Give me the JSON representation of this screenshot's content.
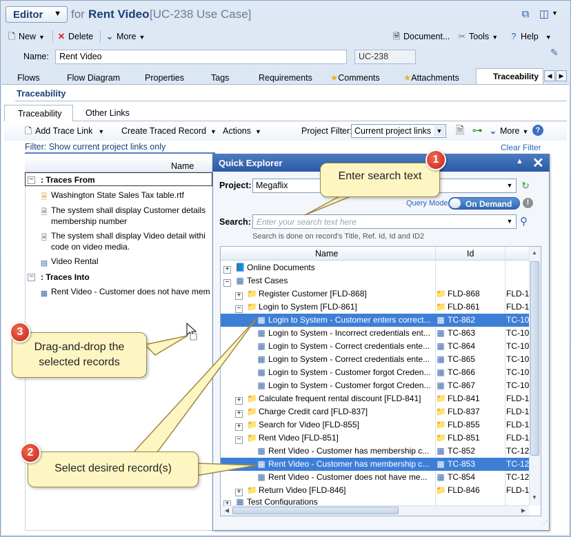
{
  "header": {
    "mode_button": "Editor",
    "for_label": "for",
    "record_name": "Rent Video",
    "record_id": "[UC-238 Use Case]"
  },
  "toolbar": {
    "new": "New",
    "delete": "Delete",
    "more": "More",
    "document": "Document...",
    "tools": "Tools",
    "help": "Help"
  },
  "name_row": {
    "label": "Name:",
    "value": "Rent Video",
    "id_value": "UC-238"
  },
  "tabs": [
    "Flows",
    "Flow Diagram",
    "Properties",
    "Tags",
    "Requirements",
    "Comments",
    "Attachments",
    "Traceability"
  ],
  "traceability": {
    "title": "Traceability",
    "subtabs": [
      "Traceability",
      "Other Links"
    ],
    "add_trace_link": "Add Trace Link",
    "create_traced_record": "Create Traced Record",
    "actions": "Actions",
    "project_filter_label": "Project Filter:",
    "project_filter_value": "Current project links",
    "more": "More",
    "filter_text": "Filter:  Show current project links only",
    "clear_filter": "Clear Filter",
    "grid_header": "Name",
    "traces_from": ": Traces From",
    "traces_into": ": Traces Into",
    "from_items": [
      "Washington State Sales Tax table.rtf",
      "The system shall display Customer details",
      "membership number",
      "The system shall display Video detail withi",
      "code on video media.",
      "Video Rental"
    ],
    "into_items": [
      "Rent Video - Customer does not have mem"
    ]
  },
  "quick_explorer": {
    "title": "Quick Explorer",
    "project_label": "Project:",
    "project_value": "Megaflix",
    "query_mode_label": "Query Mode:",
    "query_mode_value": "On Demand",
    "search_label": "Search:",
    "search_placeholder": "Enter your search text here",
    "search_hint": "Search is done on record's Title, Ref. Id, Id and ID2",
    "col_name": "Name",
    "col_id": "Id",
    "rows": [
      {
        "name": "Online Documents",
        "id": "",
        "id2": ""
      },
      {
        "name": "Test Cases",
        "id": "",
        "id2": ""
      },
      {
        "name": "Register Customer [FLD-868]",
        "id": "FLD-868",
        "id2": "FLD-1"
      },
      {
        "name": "Login to System [FLD-861]",
        "id": "FLD-861",
        "id2": "FLD-1"
      },
      {
        "name": "Login to System - Customer enters correct...",
        "id": "TC-862",
        "id2": "TC-10"
      },
      {
        "name": "Login to System - Incorrect credentials ent...",
        "id": "TC-863",
        "id2": "TC-10"
      },
      {
        "name": "Login to System - Correct credentials ente...",
        "id": "TC-864",
        "id2": "TC-10"
      },
      {
        "name": "Login to System - Correct credentials ente...",
        "id": "TC-865",
        "id2": "TC-10"
      },
      {
        "name": "Login to System - Customer forgot Creden...",
        "id": "TC-866",
        "id2": "TC-10"
      },
      {
        "name": "Login to System - Customer forgot Creden...",
        "id": "TC-867",
        "id2": "TC-10"
      },
      {
        "name": "Calculate frequent rental discount [FLD-841]",
        "id": "FLD-841",
        "id2": "FLD-1"
      },
      {
        "name": "Charge Credit card [FLD-837]",
        "id": "FLD-837",
        "id2": "FLD-1"
      },
      {
        "name": "Search for Video [FLD-855]",
        "id": "FLD-855",
        "id2": "FLD-1"
      },
      {
        "name": "Rent Video [FLD-851]",
        "id": "FLD-851",
        "id2": "FLD-1"
      },
      {
        "name": "Rent Video - Customer has membership c...",
        "id": "TC-852",
        "id2": "TC-12"
      },
      {
        "name": "Rent Video - Customer has membership c...",
        "id": "TC-853",
        "id2": "TC-12"
      },
      {
        "name": "Rent Video - Customer does not have me...",
        "id": "TC-854",
        "id2": "TC-12"
      },
      {
        "name": "Return Video [FLD-846]",
        "id": "FLD-846",
        "id2": "FLD-1"
      },
      {
        "name": "Test Configurations",
        "id": "",
        "id2": ""
      }
    ]
  },
  "callouts": {
    "c1_number": "1",
    "c1_text": "Enter search text",
    "c2_number": "2",
    "c2_text": "Select desired record(s)",
    "c3_number": "3",
    "c3_text_line1": "Drag-and-drop the",
    "c3_text_line2": "selected records"
  },
  "colors": {
    "selection": "#3e7fd6",
    "header_blue": "#2a5aa4",
    "callout_fill": "#fdf6c3",
    "badge_red": "#c2231a"
  }
}
